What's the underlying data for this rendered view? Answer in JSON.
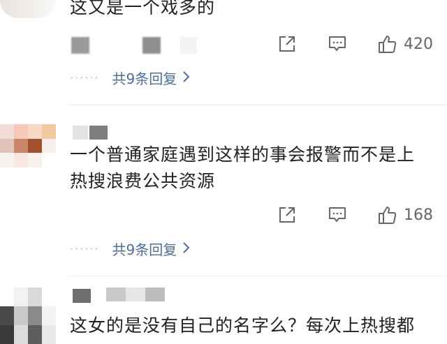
{
  "comments": [
    {
      "text_lines": [
        "这又是一个戏多的"
      ],
      "like_count": "420",
      "replies_label": "共9条回复"
    },
    {
      "text_lines": [
        "一个普通家庭遇到这样的事会报警而不是上",
        "热搜浪费公共资源"
      ],
      "like_count": "168",
      "replies_label": "共9条回复"
    },
    {
      "text_lines": [
        "这女的是没有自己的名字么？每次上热搜都"
      ]
    }
  ],
  "icons": {
    "share": "share-icon",
    "comment": "comment-icon",
    "like": "thumbs-up-icon",
    "chevron": "chevron-right-icon"
  },
  "colors": {
    "reply_link": "#4a6fa5",
    "text": "#222222",
    "muted": "#666666"
  }
}
